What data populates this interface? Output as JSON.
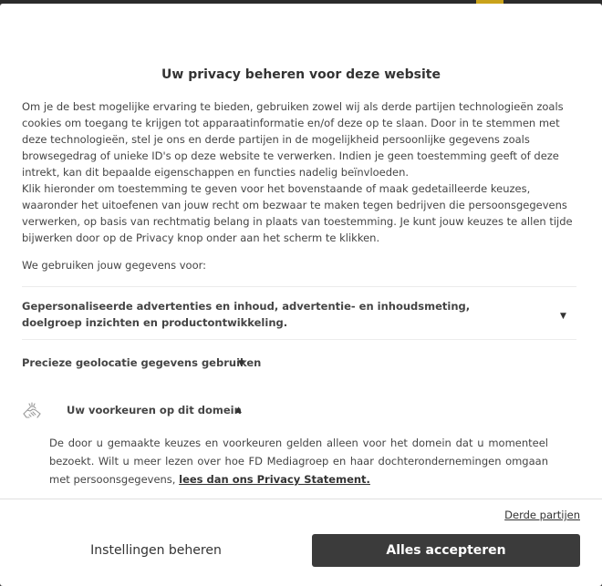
{
  "dialog": {
    "title": "Uw privacy beheren voor deze website",
    "intro_p1": "Om je de best mogelijke ervaring te bieden, gebruiken zowel wij als derde partijen technologieën zoals cookies om toegang te krijgen tot apparaatinformatie en/of deze op te slaan. Door in te stemmen met deze technologieën, stel je ons en derde partijen in de mogelijkheid persoonlijke gegevens zoals browsegedrag of unieke ID's op deze website te verwerken. Indien je geen toestemming geeft of deze intrekt, kan dit bepaalde eigenschappen en functies nadelig beïnvloeden.",
    "intro_p2": "Klik hieronder om toestemming te geven voor het bovenstaande of maak gedetailleerde keuzes, waaronder het uitoefenen van jouw recht om bezwaar te maken tegen bedrijven die persoonsgegevens verwerken, op basis van rechtmatig belang in plaats van toestemming. Je kunt jouw keuzes te allen tijde bijwerken door op de Privacy knop onder aan het scherm te klikken.",
    "uses_label": "We gebruiken jouw gegevens voor:",
    "purposes": [
      {
        "label": "Gepersonaliseerde advertenties en inhoud, advertentie- en inhoudsmeting, doelgroep inzichten en productontwikkeling."
      },
      {
        "label": "Precieze geolocatie gegevens gebruiken"
      }
    ],
    "domain_section": {
      "label": "Uw voorkeuren op dit domein",
      "text": "De door u gemaakte keuzes en voorkeuren gelden alleen voor het domein dat u momenteel bezoekt. Wilt u meer lezen over hoe FD Mediagroep en haar dochterondernemingen omgaan met persoonsgegevens, ",
      "link": "lees dan ons Privacy Statement."
    },
    "third_parties_link": "Derde partijen",
    "settings_button": "Instellingen beheren",
    "accept_button": "Alles accepteren"
  },
  "icons": {
    "caret_down": "caret-down-icon",
    "caret_up": "caret-up-icon",
    "handshake": "handshake-icon"
  },
  "colors": {
    "accept_bg": "#3b3b3b",
    "backdrop": "#3a3a3a",
    "text": "#444444"
  }
}
